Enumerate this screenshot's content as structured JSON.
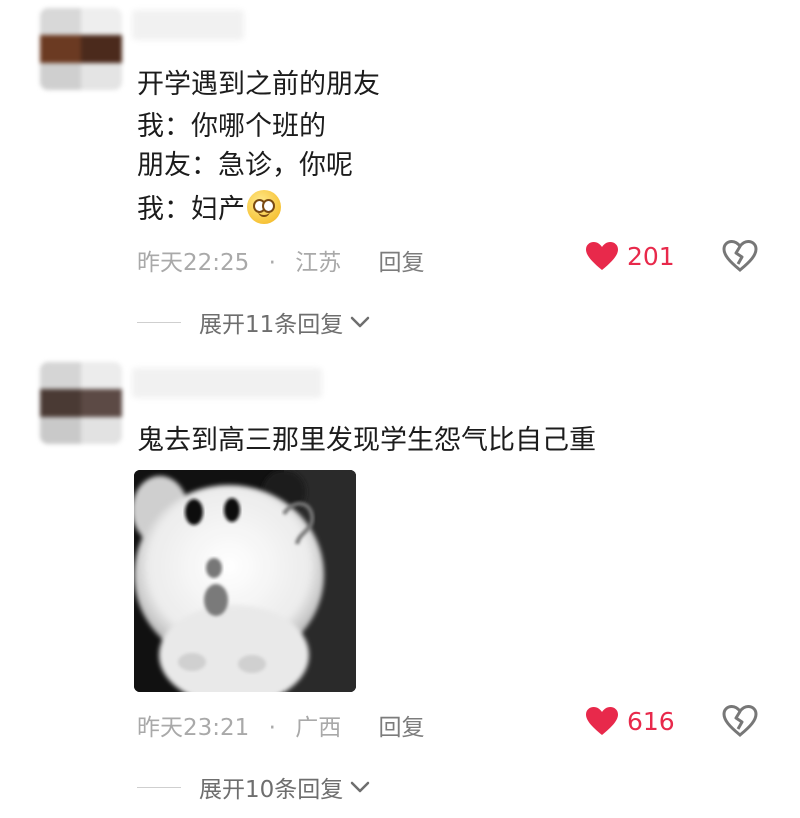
{
  "comments": [
    {
      "lines": [
        "开学遇到之前的朋友",
        "我：你哪个班的",
        "朋友：急诊，你呢",
        "我：妇产"
      ],
      "emoji": "smiling-face-emoji",
      "time": "昨天22:25",
      "separator": "·",
      "location": "江苏",
      "reply_label": "回复",
      "likes": "201",
      "expand_label": "展开11条回复"
    },
    {
      "lines": [
        "鬼去到高三那里发现学生怨气比自己重"
      ],
      "image": "hamster-meme",
      "time": "昨天23:21",
      "separator": "·",
      "location": "广西",
      "reply_label": "回复",
      "likes": "616",
      "expand_label": "展开10条回复"
    }
  ],
  "colors": {
    "like_red": "#e8294b",
    "meta_gray": "#a9a9a9",
    "expand_gray": "#6e6e6e"
  },
  "icons": [
    "heart-icon",
    "broken-heart-icon",
    "chevron-down-icon"
  ]
}
